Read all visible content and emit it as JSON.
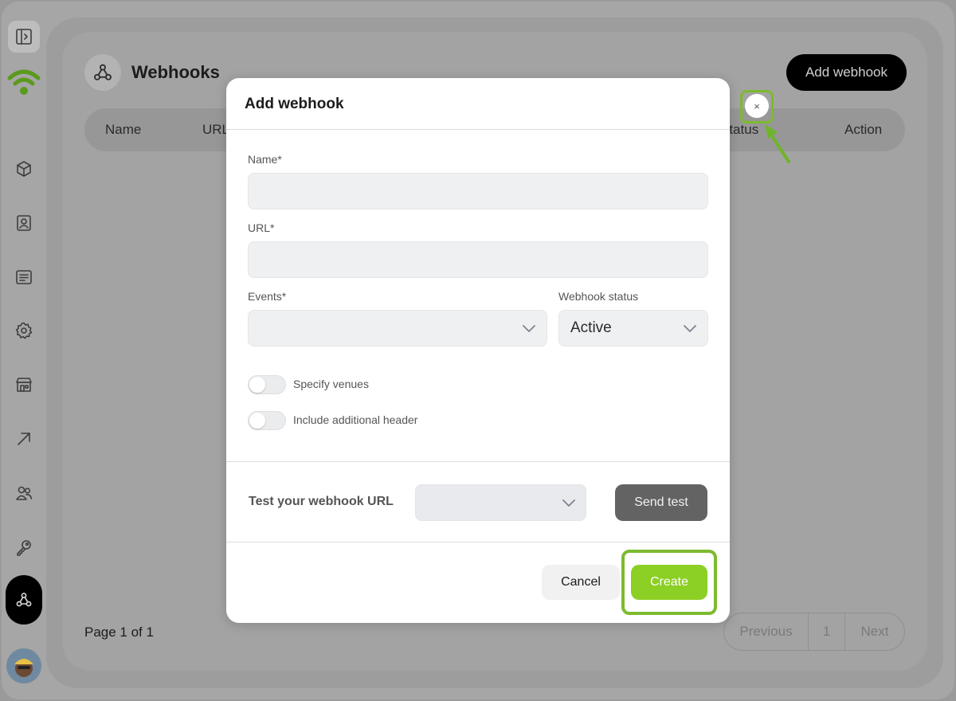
{
  "page": {
    "title": "Webhooks",
    "add_button": "Add webhook",
    "table_headers": [
      "Name",
      "URL",
      "Status",
      "Action"
    ],
    "page_info": "Page 1 of 1",
    "pagination": {
      "previous": "Previous",
      "current": "1",
      "next": "Next"
    }
  },
  "sidebar": {
    "icons": [
      "panel-toggle-icon",
      "cube-icon",
      "contact-card-icon",
      "list-icon",
      "settings-icon",
      "store-icon",
      "arrow-up-right-icon",
      "users-icon",
      "key-icon",
      "webhook-icon"
    ],
    "active": "webhook-icon"
  },
  "modal": {
    "title": "Add webhook",
    "name_label": "Name*",
    "url_label": "URL*",
    "events_label": "Events*",
    "status_label": "Webhook status",
    "status_value": "Active",
    "toggle_venues": "Specify venues",
    "toggle_header": "Include additional header",
    "test_label": "Test your webhook URL",
    "send_test": "Send test",
    "cancel": "Cancel",
    "create": "Create",
    "close_symbol": "×"
  },
  "colors": {
    "accent": "#8ccf25",
    "highlight": "#7dba2f",
    "overlay": "#a6a6a6"
  }
}
